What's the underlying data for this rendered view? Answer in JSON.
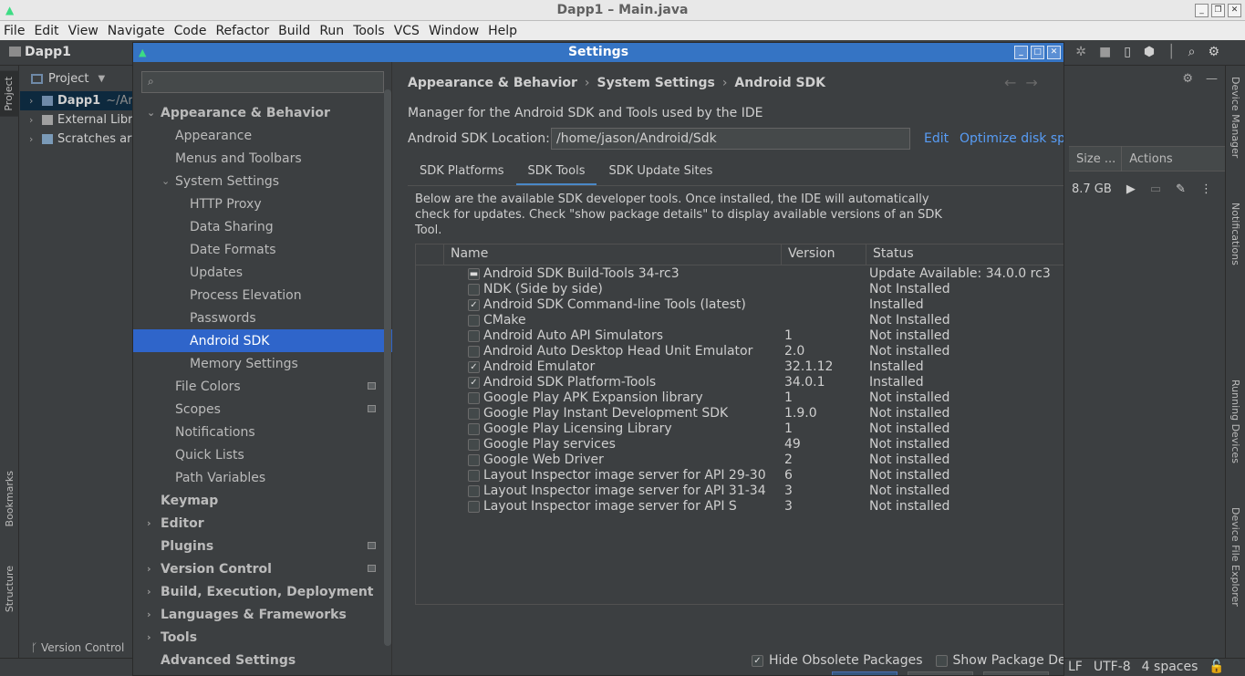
{
  "window": {
    "title": "Dapp1 – Main.java"
  },
  "menu": [
    "File",
    "Edit",
    "View",
    "Navigate",
    "Code",
    "Refactor",
    "Build",
    "Run",
    "Tools",
    "VCS",
    "Window",
    "Help"
  ],
  "navbar": {
    "project": "Dapp1"
  },
  "left_strip": {
    "project_tab": "Project",
    "bookmarks_tab": "Bookmarks",
    "structure_tab": "Structure"
  },
  "project_panel": {
    "header": "Project",
    "rows": [
      {
        "label": "Dapp1",
        "suffix": "~/Ar"
      },
      {
        "label": "External Libr"
      },
      {
        "label": "Scratches ar"
      }
    ]
  },
  "right_panel": {
    "col_size": "Size ...",
    "col_actions": "Actions",
    "device_size": "8.7 GB"
  },
  "right_strip": {
    "device_manager": "Device Manager",
    "notifications": "Notifications",
    "running_devices": "Running Devices",
    "file_explorer": "Device File Explorer"
  },
  "statusbar": {
    "version_control": "Version Control",
    "line_sep": "LF",
    "encoding": "UTF-8",
    "indent": "4 spaces"
  },
  "dialog": {
    "title": "Settings",
    "search": {
      "value": "",
      "placeholder": ""
    },
    "tree": [
      {
        "label": "Appearance & Behavior",
        "level": 0,
        "bold": true,
        "arrow": "down"
      },
      {
        "label": "Appearance",
        "level": 1
      },
      {
        "label": "Menus and Toolbars",
        "level": 1
      },
      {
        "label": "System Settings",
        "level": 1,
        "arrow": "down"
      },
      {
        "label": "HTTP Proxy",
        "level": 2
      },
      {
        "label": "Data Sharing",
        "level": 2
      },
      {
        "label": "Date Formats",
        "level": 2
      },
      {
        "label": "Updates",
        "level": 2
      },
      {
        "label": "Process Elevation",
        "level": 2
      },
      {
        "label": "Passwords",
        "level": 2
      },
      {
        "label": "Android SDK",
        "level": 2,
        "selected": true
      },
      {
        "label": "Memory Settings",
        "level": 2
      },
      {
        "label": "File Colors",
        "level": 1,
        "project": true
      },
      {
        "label": "Scopes",
        "level": 1,
        "project": true
      },
      {
        "label": "Notifications",
        "level": 1
      },
      {
        "label": "Quick Lists",
        "level": 1
      },
      {
        "label": "Path Variables",
        "level": 1
      },
      {
        "label": "Keymap",
        "level": 0,
        "bold": true
      },
      {
        "label": "Editor",
        "level": 0,
        "bold": true,
        "arrow": "right"
      },
      {
        "label": "Plugins",
        "level": 0,
        "bold": true,
        "project": true
      },
      {
        "label": "Version Control",
        "level": 0,
        "bold": true,
        "arrow": "right",
        "project": true
      },
      {
        "label": "Build, Execution, Deployment",
        "level": 0,
        "bold": true,
        "arrow": "right"
      },
      {
        "label": "Languages & Frameworks",
        "level": 0,
        "bold": true,
        "arrow": "right"
      },
      {
        "label": "Tools",
        "level": 0,
        "bold": true,
        "arrow": "right"
      },
      {
        "label": "Advanced Settings",
        "level": 0,
        "bold": true
      }
    ],
    "breadcrumb": [
      "Appearance & Behavior",
      "System Settings",
      "Android SDK"
    ],
    "description": "Manager for the Android SDK and Tools used by the IDE",
    "sdk_location_label": "Android SDK Location:",
    "sdk_location_value": "/home/jason/Android/Sdk",
    "edit_link": "Edit",
    "optimize_link": "Optimize disk spa",
    "tabs": [
      {
        "label": "SDK Platforms",
        "active": false
      },
      {
        "label": "SDK Tools",
        "active": true
      },
      {
        "label": "SDK Update Sites",
        "active": false
      }
    ],
    "tools_description": "Below are the available SDK developer tools. Once installed, the IDE will automatically check for updates. Check \"show package details\" to display available versions of an SDK Tool.",
    "table": {
      "columns": [
        "Name",
        "Version",
        "Status"
      ],
      "rows": [
        {
          "check": "partial",
          "name": "Android SDK Build-Tools 34-rc3",
          "version": "",
          "status": "Update Available: 34.0.0 rc3"
        },
        {
          "check": "off",
          "name": "NDK (Side by side)",
          "version": "",
          "status": "Not Installed"
        },
        {
          "check": "on",
          "name": "Android SDK Command-line Tools (latest)",
          "version": "",
          "status": "Installed"
        },
        {
          "check": "off",
          "name": "CMake",
          "version": "",
          "status": "Not Installed"
        },
        {
          "check": "off",
          "name": "Android Auto API Simulators",
          "version": "1",
          "status": "Not installed"
        },
        {
          "check": "off",
          "name": "Android Auto Desktop Head Unit Emulator",
          "version": "2.0",
          "status": "Not installed"
        },
        {
          "check": "on",
          "name": "Android Emulator",
          "version": "32.1.12",
          "status": "Installed"
        },
        {
          "check": "on",
          "name": "Android SDK Platform-Tools",
          "version": "34.0.1",
          "status": "Installed"
        },
        {
          "check": "off",
          "name": "Google Play APK Expansion library",
          "version": "1",
          "status": "Not installed"
        },
        {
          "check": "off",
          "name": "Google Play Instant Development SDK",
          "version": "1.9.0",
          "status": "Not installed"
        },
        {
          "check": "off",
          "name": "Google Play Licensing Library",
          "version": "1",
          "status": "Not installed"
        },
        {
          "check": "off",
          "name": "Google Play services",
          "version": "49",
          "status": "Not installed"
        },
        {
          "check": "off",
          "name": "Google Web Driver",
          "version": "2",
          "status": "Not installed"
        },
        {
          "check": "off",
          "name": "Layout Inspector image server for API 29-30",
          "version": "6",
          "status": "Not installed"
        },
        {
          "check": "off",
          "name": "Layout Inspector image server for API 31-34",
          "version": "3",
          "status": "Not installed"
        },
        {
          "check": "off",
          "name": "Layout Inspector image server for API S",
          "version": "3",
          "status": "Not installed"
        }
      ]
    },
    "hide_obsolete": {
      "label": "Hide Obsolete Packages",
      "checked": true
    },
    "show_details": {
      "label": "Show Package Detai",
      "checked": false
    }
  }
}
